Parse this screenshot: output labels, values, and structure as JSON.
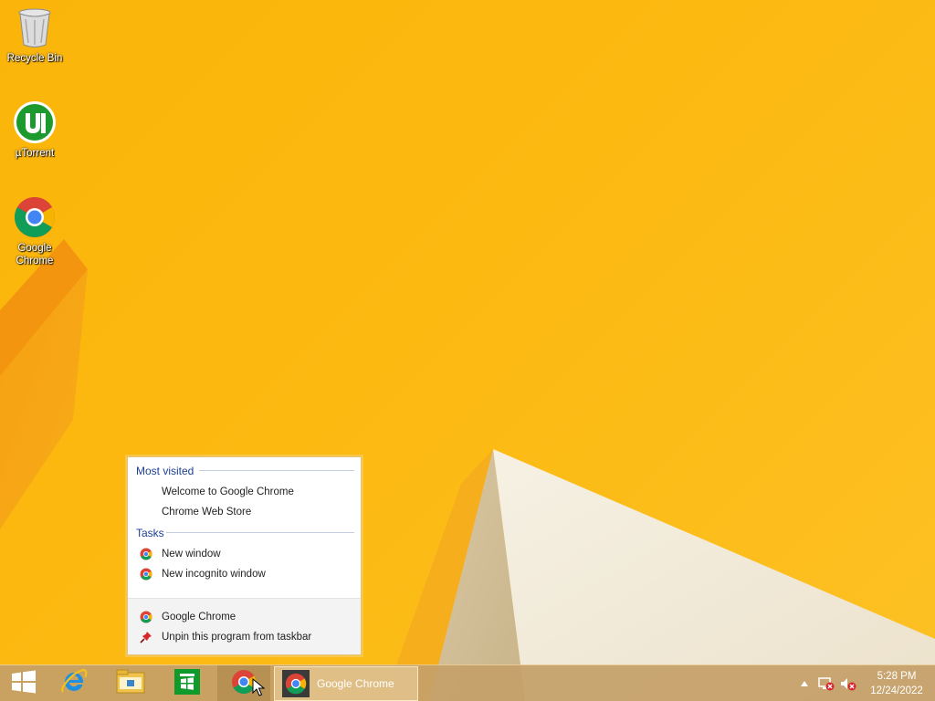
{
  "desktop": {
    "icons": [
      {
        "label": "Recycle Bin",
        "icon": "recycle-bin-icon"
      },
      {
        "label": "µTorrent",
        "icon": "utorrent-icon"
      },
      {
        "label": "Google\nChrome",
        "icon": "chrome-icon"
      }
    ]
  },
  "jumplist": {
    "most_visited_header": "Most visited",
    "most_visited": [
      {
        "label": "Welcome to Google Chrome"
      },
      {
        "label": "Chrome Web Store"
      }
    ],
    "tasks_header": "Tasks",
    "tasks": [
      {
        "label": "New window",
        "icon": "chrome-icon"
      },
      {
        "label": "New incognito window",
        "icon": "chrome-icon"
      }
    ],
    "footer": [
      {
        "label": "Google Chrome",
        "icon": "chrome-icon"
      },
      {
        "label": "Unpin this program from taskbar",
        "icon": "pin-icon"
      }
    ]
  },
  "taskbar": {
    "start_icon": "windows-start-icon",
    "pinned": [
      "internet-explorer-icon",
      "file-explorer-icon",
      "windows-store-icon",
      "chrome-icon"
    ],
    "active_window_label": "Google Chrome",
    "tray_icons": [
      "show-hidden-icons-arrow",
      "network-disconnected-icon",
      "volume-muted-icon"
    ],
    "clock_time": "5:28 PM",
    "clock_date": "12/24/2022"
  },
  "colors": {
    "wallpaper": "#fbb50a",
    "jumplist_header": "#1c3f94"
  }
}
